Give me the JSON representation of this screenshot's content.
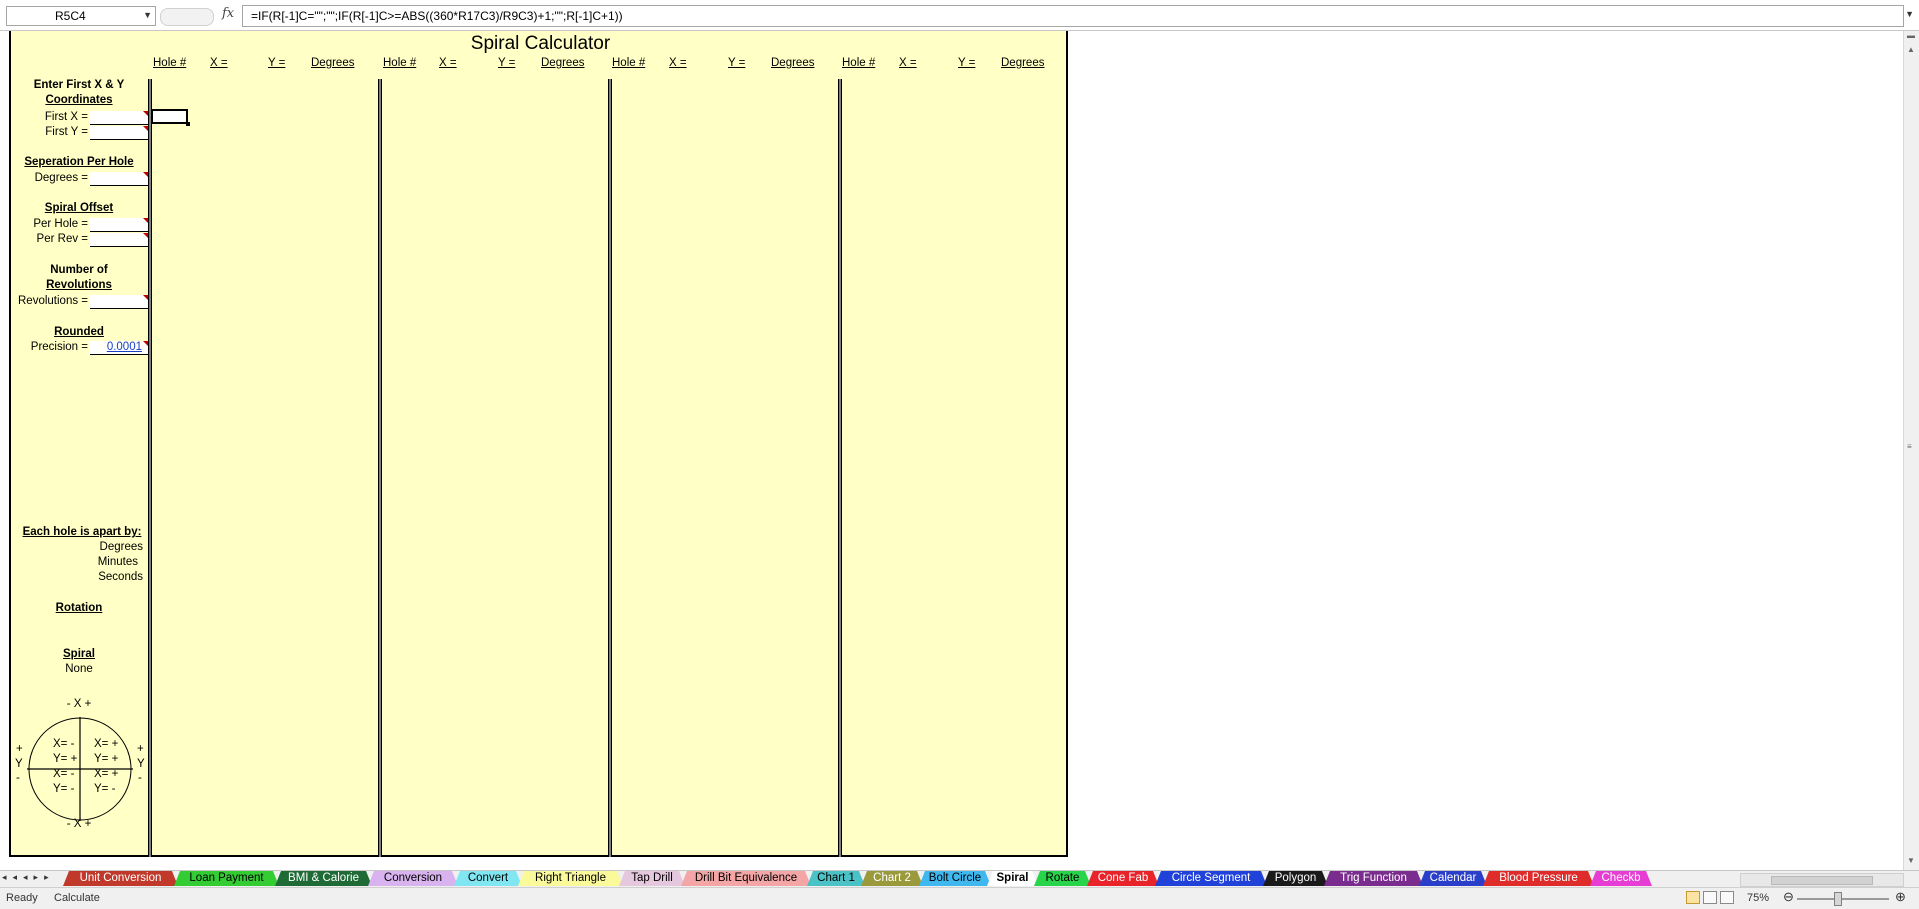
{
  "formula_bar": {
    "name_box": "R5C4",
    "formula": "=IF(R[-1]C=\"\";\"\";IF(R[-1]C>=ABS((360*R17C3)/R9C3)+1;\"\";R[-1]C+1))",
    "fx_label": "fx"
  },
  "sheet": {
    "title": "Spiral Calculator",
    "column_headers": [
      {
        "hole": "Hole #",
        "x": "X =",
        "y": "Y =",
        "deg": "Degrees"
      },
      {
        "hole": "Hole #",
        "x": "X =",
        "y": "Y =",
        "deg": "Degrees"
      },
      {
        "hole": "Hole #",
        "x": "X =",
        "y": "Y =",
        "deg": "Degrees"
      },
      {
        "hole": "Hole #",
        "x": "X =",
        "y": "Y =",
        "deg": "Degrees"
      }
    ],
    "inputs": {
      "enter_first_line1": "Enter First X & Y",
      "enter_first_line2": "Coordinates",
      "first_x_label": "First X =",
      "first_y_label": "First Y =",
      "first_x_value": "",
      "first_y_value": "",
      "separation_heading": "Seperation Per Hole",
      "degrees_label": "Degrees =",
      "degrees_value": "",
      "spiral_offset_heading": "Spiral Offset",
      "per_hole_label": "Per Hole =",
      "per_hole_value": "",
      "per_rev_label": "Per Rev =",
      "per_rev_value": "",
      "number_of_line1": "Number of",
      "number_of_line2": "Revolutions",
      "revolutions_label": "Revolutions =",
      "revolutions_value": "",
      "rounded_heading": "Rounded",
      "precision_label": "Precision =",
      "precision_value": "0.0001"
    },
    "results": {
      "apart_heading": "Each hole is apart by:",
      "degrees": "Degrees",
      "minutes": "Minutes",
      "seconds": "Seconds",
      "rotation_heading": "Rotation",
      "spiral_heading": "Spiral",
      "spiral_value": "None"
    },
    "quadrant": {
      "top_label": "- X +",
      "bottom_label": "- X +",
      "left_plus": "+",
      "left_y": "Y",
      "left_minus": "-",
      "right_plus": "+",
      "right_y": "Y",
      "right_minus": "-",
      "q2_x": "X= -",
      "q2_y": "Y= +",
      "q1_x": "X= +",
      "q1_y": "Y= +",
      "q3_x": "X= -",
      "q3_y": "Y= -",
      "q4_x": "X= +",
      "q4_y": "Y= -"
    }
  },
  "tabs": [
    {
      "label": "Unit Conversion",
      "color": "#c0392b",
      "text": "#ffffff"
    },
    {
      "label": "Loan Payment",
      "color": "#33cc33",
      "text": "#000000"
    },
    {
      "label": "BMI & Calorie",
      "color": "#1e6b35",
      "text": "#ffffff"
    },
    {
      "label": "Conversion",
      "color": "#d9b3f0",
      "text": "#000000"
    },
    {
      "label": "Convert",
      "color": "#7fe6f2",
      "text": "#000000"
    },
    {
      "label": "Right Triangle",
      "color": "#fafa9a",
      "text": "#000000"
    },
    {
      "label": "Tap Drill",
      "color": "#e5c7de",
      "text": "#000000"
    },
    {
      "label": "Drill Bit Equivalence",
      "color": "#f4a6a6",
      "text": "#000000"
    },
    {
      "label": "Chart 1",
      "color": "#4bc2c6",
      "text": "#000000"
    },
    {
      "label": "Chart 2",
      "color": "#9a9a3c",
      "text": "#ffffff"
    },
    {
      "label": "Bolt Circle",
      "color": "#3fb8f0",
      "text": "#000000"
    },
    {
      "label": "Spiral",
      "color": "#ffffff",
      "text": "#000000"
    },
    {
      "label": "Rotate",
      "color": "#27d44a",
      "text": "#000000"
    },
    {
      "label": "Cone Fab",
      "color": "#e8232a",
      "text": "#ffffff"
    },
    {
      "label": "Circle Segment",
      "color": "#2042d8",
      "text": "#ffffff"
    },
    {
      "label": "Polygon",
      "color": "#1a1a1a",
      "text": "#ffffff"
    },
    {
      "label": "Trig Function",
      "color": "#7a2d8f",
      "text": "#ffffff"
    },
    {
      "label": "Calendar",
      "color": "#2a3fc9",
      "text": "#ffffff"
    },
    {
      "label": "Blood Pressure",
      "color": "#e02b2b",
      "text": "#ffffff"
    },
    {
      "label": "Checkb",
      "color": "#e63dd4",
      "text": "#ffffff"
    }
  ],
  "status_bar": {
    "ready": "Ready",
    "calculate": "Calculate",
    "zoom": "75%"
  }
}
